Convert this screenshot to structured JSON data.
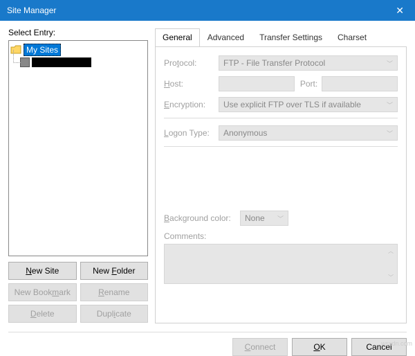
{
  "window": {
    "title": "Site Manager"
  },
  "left": {
    "label": "Select Entry:",
    "root": "My Sites",
    "buttons": {
      "new_site": "New Site",
      "new_folder": "New Folder",
      "new_bookmark": "New Bookmark",
      "rename": "Rename",
      "delete": "Delete",
      "duplicate": "Duplicate"
    }
  },
  "tabs": {
    "general": "General",
    "advanced": "Advanced",
    "transfer": "Transfer Settings",
    "charset": "Charset"
  },
  "general": {
    "protocol_label": "Protocol:",
    "protocol_value": "FTP - File Transfer Protocol",
    "host_label": "Host:",
    "port_label": "Port:",
    "encryption_label": "Encryption:",
    "encryption_value": "Use explicit FTP over TLS if available",
    "logon_label": "Logon Type:",
    "logon_value": "Anonymous",
    "bgcolor_label": "Background color:",
    "bgcolor_value": "None",
    "comments_label": "Comments:"
  },
  "footer": {
    "connect": "Connect",
    "ok": "OK",
    "cancel": "Cancel"
  },
  "watermark": "wsxdn.com"
}
